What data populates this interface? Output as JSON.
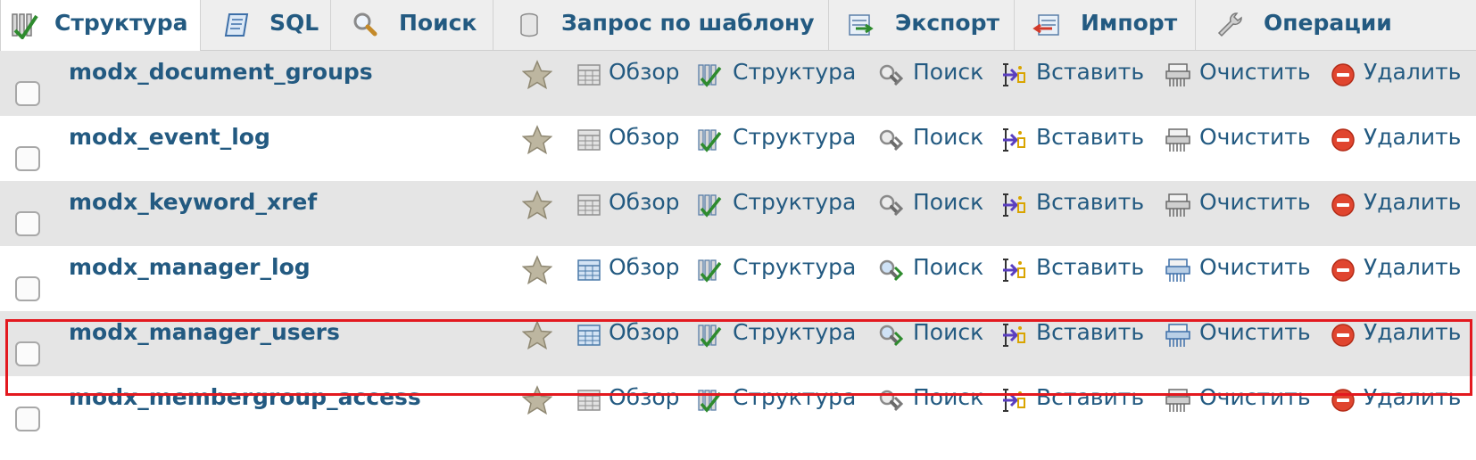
{
  "tabs": [
    {
      "label": "Структура",
      "icon": "structure-icon",
      "active": true
    },
    {
      "label": "SQL",
      "icon": "sql-document-icon",
      "active": false
    },
    {
      "label": "Поиск",
      "icon": "search-icon",
      "active": false
    },
    {
      "label": "Запрос по шаблону",
      "icon": "query-db-icon",
      "active": false
    },
    {
      "label": "Экспорт",
      "icon": "export-icon",
      "active": false
    },
    {
      "label": "Импорт",
      "icon": "import-icon",
      "active": false
    },
    {
      "label": "Операции",
      "icon": "wrench-icon",
      "active": false
    }
  ],
  "actions": {
    "browse": "Обзор",
    "structure": "Структура",
    "search": "Поиск",
    "insert": "Вставить",
    "empty": "Очистить",
    "drop": "Удалить"
  },
  "tables": [
    {
      "name": "modx_document_groups",
      "has_rows": false,
      "highlighted": false
    },
    {
      "name": "modx_event_log",
      "has_rows": false,
      "highlighted": false
    },
    {
      "name": "modx_keyword_xref",
      "has_rows": false,
      "highlighted": false
    },
    {
      "name": "modx_manager_log",
      "has_rows": true,
      "highlighted": false
    },
    {
      "name": "modx_manager_users",
      "has_rows": true,
      "highlighted": true
    },
    {
      "name": "modx_membergroup_access",
      "has_rows": false,
      "highlighted": false
    }
  ],
  "colors": {
    "link": "#235a81",
    "highlight_border": "#e3191f",
    "row_odd": "#e5e5e5",
    "row_even": "#ffffff",
    "drop_icon": "#e0452f"
  }
}
